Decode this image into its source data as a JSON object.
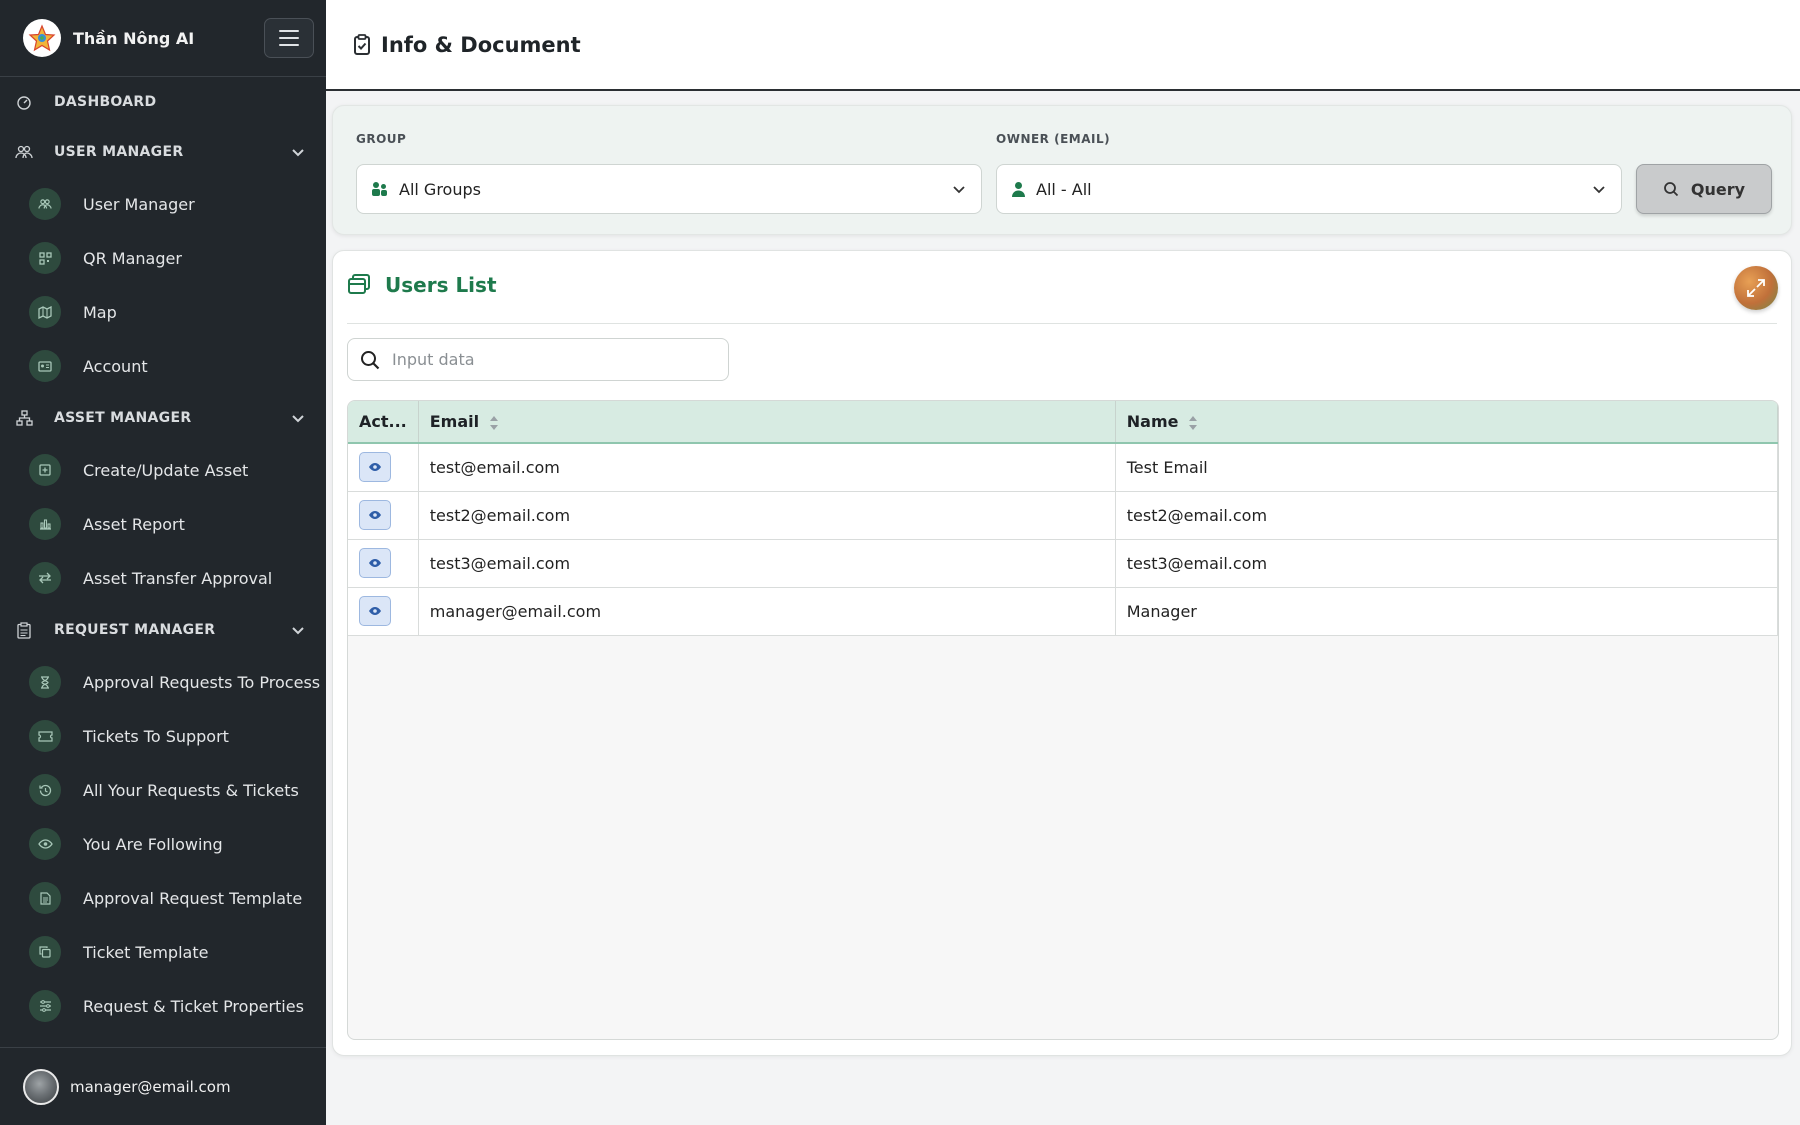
{
  "sidebar": {
    "brand": "Thần Nông AI",
    "sections": [
      {
        "label": "DASHBOARD",
        "icon": "dashboard-icon"
      },
      {
        "label": "USER MANAGER",
        "icon": "users-icon",
        "items": [
          {
            "label": "User Manager",
            "icon": "users-icon"
          },
          {
            "label": "QR Manager",
            "icon": "qr-icon"
          },
          {
            "label": "Map",
            "icon": "map-icon"
          },
          {
            "label": "Account",
            "icon": "id-card-icon"
          }
        ]
      },
      {
        "label": "ASSET MANAGER",
        "icon": "hierarchy-icon",
        "items": [
          {
            "label": "Create/Update Asset",
            "icon": "plus-square-icon"
          },
          {
            "label": "Asset Report",
            "icon": "bar-chart-icon"
          },
          {
            "label": "Asset Transfer Approval",
            "icon": "transfer-icon"
          }
        ]
      },
      {
        "label": "REQUEST MANAGER",
        "icon": "clipboard-icon",
        "items": [
          {
            "label": "Approval Requests To Process",
            "icon": "hourglass-icon"
          },
          {
            "label": "Tickets To Support",
            "icon": "ticket-icon"
          },
          {
            "label": "All Your Requests & Tickets",
            "icon": "history-icon"
          },
          {
            "label": "You Are Following",
            "icon": "eye-icon"
          },
          {
            "label": "Approval Request Template",
            "icon": "document-icon"
          },
          {
            "label": "Ticket Template",
            "icon": "copy-icon"
          },
          {
            "label": "Request & Ticket Properties",
            "icon": "sliders-icon"
          }
        ]
      }
    ],
    "user_email": "manager@email.com"
  },
  "header": {
    "title": "Info & Document"
  },
  "filters": {
    "group_label": "GROUP",
    "group_value": "All Groups",
    "owner_label": "OWNER (EMAIL)",
    "owner_value": "All - All",
    "query_label": "Query"
  },
  "users": {
    "title": "Users List",
    "search_placeholder": "Input data",
    "columns": [
      "Act...",
      "Email",
      "Name"
    ],
    "rows": [
      {
        "email": "test@email.com",
        "name": "Test Email"
      },
      {
        "email": "test2@email.com",
        "name": "test2@email.com"
      },
      {
        "email": "test3@email.com",
        "name": "test3@email.com"
      },
      {
        "email": "manager@email.com",
        "name": "Manager"
      }
    ]
  },
  "colors": {
    "sidebar_bg": "#22272c",
    "accent_green": "#1e7a4c",
    "table_header_bg": "#d7ebe2"
  }
}
